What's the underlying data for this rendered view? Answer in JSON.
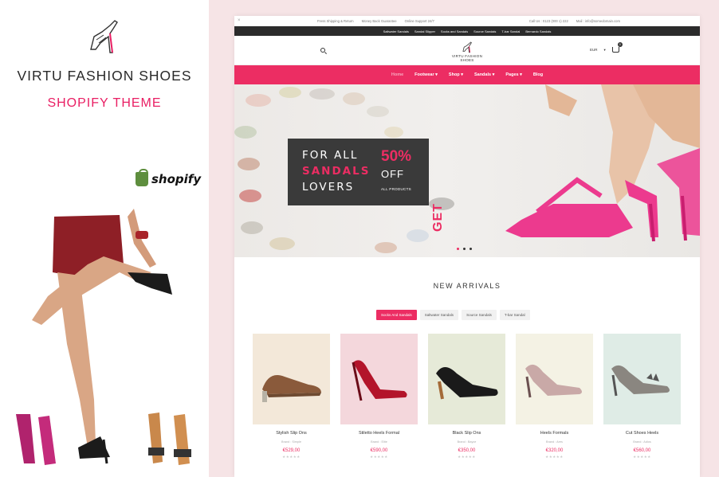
{
  "promo": {
    "title": "VIRTU FASHION SHOES",
    "subtitle": "SHOPIFY THEME",
    "platform": "shopify"
  },
  "topbar": {
    "left": [
      "Fress Shipping & Return",
      "Money Back Guarantee",
      "Online Support 24/7"
    ],
    "right": [
      "Call Us : 0123 (000 1) 222",
      "Mail : info@somedomain.com"
    ]
  },
  "categories": [
    "Saltwater Sandals",
    "Sandal Slipper",
    "Socks and Sandals",
    "Source Sandals",
    "T-bar Sandal",
    "Bernardo Sandals"
  ],
  "header": {
    "logo_text": "VIRTU FASHION SHOES",
    "currency": "EUR",
    "cart_count": "0"
  },
  "nav": [
    {
      "label": "Home",
      "active": true
    },
    {
      "label": "Footwear",
      "caret": "▾"
    },
    {
      "label": "Shop",
      "caret": "▾"
    },
    {
      "label": "Sandals",
      "caret": "▾"
    },
    {
      "label": "Pages",
      "caret": "▾"
    },
    {
      "label": "Blog"
    }
  ],
  "hero": {
    "line1": "FOR ALL",
    "line2": "SANDALS",
    "line3": "LOVERS",
    "get": "GET",
    "percent": "50%",
    "off": "OFF",
    "all_products": "ALL PRODUCTS",
    "slides": 3,
    "active_slide": 1
  },
  "arrivals": {
    "title": "NEW ARRIVALS",
    "tabs": [
      "Socks And Sandals",
      "Saltwater Sandals",
      "Source Sandals",
      "T-bar Sandal"
    ]
  },
  "products": [
    {
      "name": "Stylish Slip Ons",
      "meta": "Brand :  Simple",
      "price": "€529,00",
      "bg": "#f3e8d9"
    },
    {
      "name": "Stiletto Heels Formal",
      "meta": "Brand :  Elite",
      "price": "€590,00",
      "bg": "#f4d7dc"
    },
    {
      "name": "Black Slip Ons",
      "meta": "Brand :  Bayce",
      "price": "€350,00",
      "bg": "#e6ead8"
    },
    {
      "name": "Heels Formals",
      "meta": "Brand :  Ares",
      "price": "€320,00",
      "bg": "#f4f2e4"
    },
    {
      "name": "Cut Shoes Heels",
      "meta": "Brand :  Adios",
      "price": "€560,00",
      "bg": "#dfece6"
    }
  ],
  "colors": {
    "accent": "#ec2d63",
    "dark": "#2b2b2b",
    "stage": "#f6e4e6"
  },
  "stars": "★★★★★"
}
